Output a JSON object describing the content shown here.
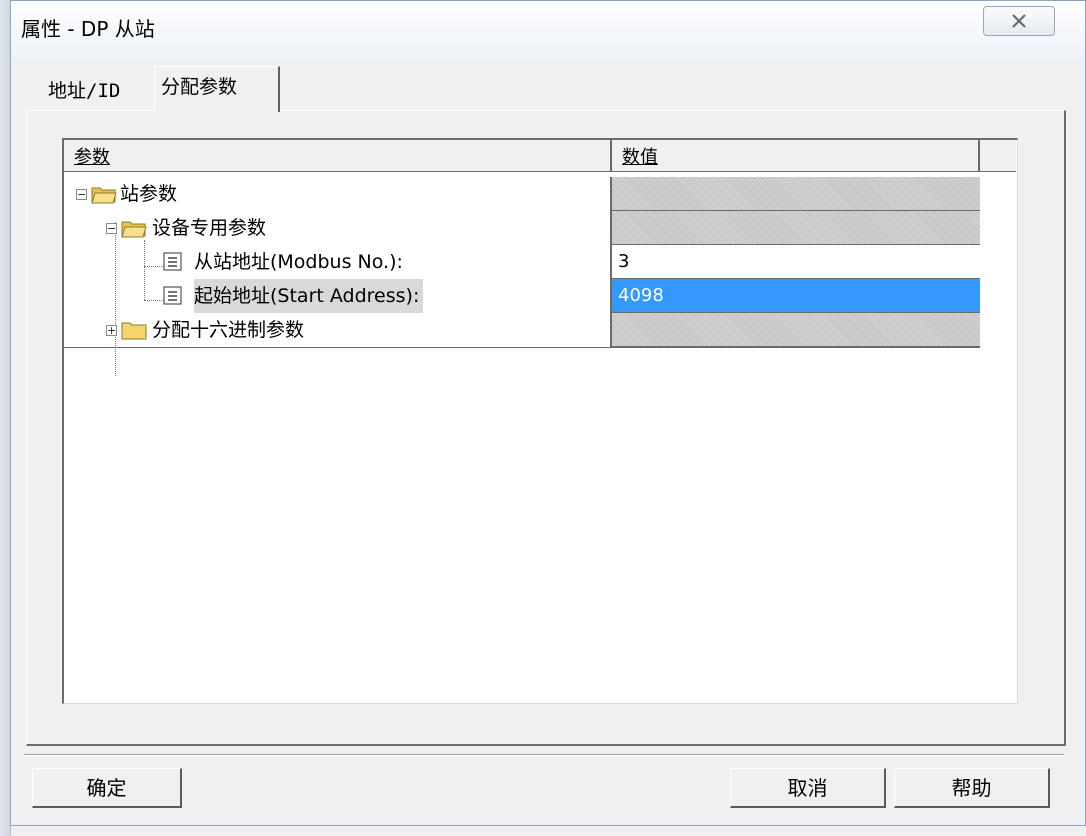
{
  "window": {
    "title": "属性 - DP 从站",
    "close_glyph": "X"
  },
  "tabs": [
    {
      "label": "地址/ID",
      "active": false
    },
    {
      "label": "分配参数",
      "active": true
    }
  ],
  "grid": {
    "columns": {
      "param": "参数",
      "value": "数值"
    },
    "rows": [
      {
        "label": "站参数",
        "value": "",
        "expander": "-",
        "type": "folder-open",
        "cell": "hatched"
      },
      {
        "label": "设备专用参数",
        "value": "",
        "expander": "-",
        "type": "folder-open",
        "cell": "hatched"
      },
      {
        "label": "从站地址(Modbus No.):",
        "value": "3",
        "type": "document",
        "cell": "white"
      },
      {
        "label": "起始地址(Start Address):",
        "value": "4098",
        "type": "document",
        "cell": "selected"
      },
      {
        "label": "分配十六进制参数",
        "value": "",
        "expander": "+",
        "type": "folder-closed",
        "cell": "hatched"
      }
    ]
  },
  "buttons": {
    "ok": "确定",
    "cancel": "取消",
    "help": "帮助"
  },
  "colors": {
    "selection": "#3399ff",
    "dialog_bg": "#f0f0f0",
    "folder": "#f3d56a"
  }
}
